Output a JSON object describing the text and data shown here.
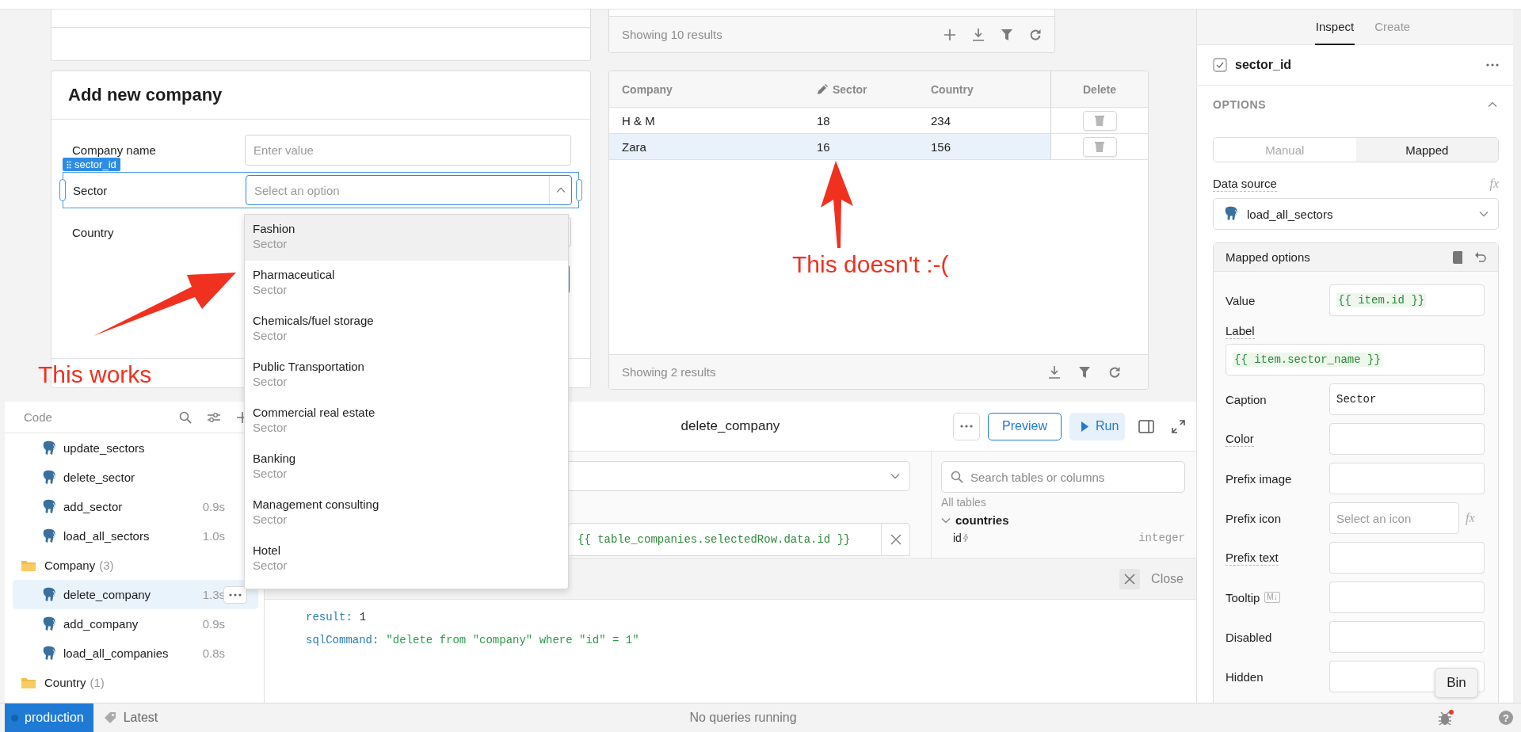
{
  "canvas": {
    "top_table": {
      "footer": "Showing 10 results"
    },
    "form": {
      "title": "Add new company",
      "fields": [
        {
          "label": "Company name",
          "kind": "text",
          "placeholder": "Enter value",
          "selected": false
        },
        {
          "label": "Sector",
          "kind": "select",
          "placeholder": "Select an option",
          "selected": true,
          "badge": "sector_id",
          "expanded": true
        },
        {
          "label": "Country",
          "kind": "select",
          "selected": false
        }
      ]
    },
    "dropdown": {
      "options": [
        {
          "label": "Fashion",
          "caption": "Sector",
          "selected": true
        },
        {
          "label": "Pharmaceutical",
          "caption": "Sector",
          "selected": false
        },
        {
          "label": "Chemicals/fuel storage",
          "caption": "Sector",
          "selected": false
        },
        {
          "label": "Public Transportation",
          "caption": "Sector",
          "selected": false
        },
        {
          "label": "Commercial real estate",
          "caption": "Sector",
          "selected": false
        },
        {
          "label": "Banking",
          "caption": "Sector",
          "selected": false
        },
        {
          "label": "Management consulting",
          "caption": "Sector",
          "selected": false
        },
        {
          "label": "Hotel",
          "caption": "Sector",
          "selected": false
        }
      ]
    },
    "table": {
      "columns": [
        {
          "label": "Company",
          "editable": false
        },
        {
          "label": "Sector",
          "editable": true
        },
        {
          "label": "Country",
          "editable": false
        },
        {
          "label": "Delete",
          "editable": false
        }
      ],
      "rows": [
        {
          "cells": [
            "H & M",
            "18",
            "234"
          ],
          "selected": false
        },
        {
          "cells": [
            "Zara",
            "16",
            "156"
          ],
          "selected": true
        }
      ],
      "footer": "Showing 2 results"
    },
    "annotations": [
      {
        "text": "This works"
      },
      {
        "text": "This doesn't :-("
      }
    ]
  },
  "code_panel": {
    "title": "Code",
    "items": [
      {
        "kind": "query",
        "name": "update_sectors",
        "selected": false
      },
      {
        "kind": "query",
        "name": "delete_sector",
        "selected": false
      },
      {
        "kind": "query",
        "name": "add_sector",
        "time": "0.9s",
        "selected": false
      },
      {
        "kind": "query",
        "name": "load_all_sectors",
        "time": "1.0s",
        "selected": false
      },
      {
        "kind": "folder",
        "name": "Company",
        "count": "(3)",
        "selected": false
      },
      {
        "kind": "query",
        "name": "delete_company",
        "time": "1.3s",
        "selected": true
      },
      {
        "kind": "query",
        "name": "add_company",
        "time": "0.9s",
        "selected": false
      },
      {
        "kind": "query",
        "name": "load_all_companies",
        "time": "0.8s",
        "selected": false
      },
      {
        "kind": "folder",
        "name": "Country",
        "count": "(1)",
        "selected": false
      }
    ]
  },
  "query_editor": {
    "title": "delete_company",
    "buttons": [
      {
        "label": "Preview",
        "kind": "outline"
      },
      {
        "label": "Run",
        "kind": "primary"
      }
    ],
    "parameter": "{{ table_companies.selectedRow.data.id }}",
    "schema": {
      "search_placeholder": "Search tables or columns",
      "section": "All tables",
      "tables": [
        {
          "name": "countries",
          "expanded": true,
          "columns": [
            {
              "name": "id",
              "type": "integer"
            }
          ]
        }
      ]
    },
    "results": {
      "close_label": "Close",
      "lines": [
        {
          "key": "result:",
          "value": "1",
          "kind": "number"
        },
        {
          "key": "sqlCommand:",
          "value": "\"delete from \"company\" where \"id\" = 1\"",
          "kind": "string"
        }
      ]
    }
  },
  "inspector": {
    "tabs": [
      {
        "label": "Inspect",
        "selected": true
      },
      {
        "label": "Create",
        "selected": false
      }
    ],
    "component": {
      "name": "sector_id",
      "checked": true
    },
    "section": {
      "title": "OPTIONS",
      "expanded": true
    },
    "mode": [
      {
        "label": "Manual",
        "selected": false
      },
      {
        "label": "Mapped",
        "selected": true
      }
    ],
    "data_source": {
      "label": "Data source",
      "formula": "fx",
      "value": "load_all_sectors"
    },
    "mapped": {
      "title": "Mapped options",
      "properties": [
        {
          "label": "Value",
          "kind": "code",
          "value": "{{ item.id }}",
          "hint": false
        },
        {
          "label": "Label",
          "kind": "code_wide",
          "value": "{{ item.sector_name }}",
          "hint": true
        },
        {
          "label": "Caption",
          "kind": "text",
          "value": "Sector",
          "hint": false
        },
        {
          "label": "Color",
          "kind": "text",
          "hint": true
        },
        {
          "label": "Prefix image",
          "kind": "text",
          "hint": false
        },
        {
          "label": "Prefix icon",
          "kind": "icon_select",
          "placeholder": "Select an icon",
          "formula": "fx",
          "hint": false
        },
        {
          "label": "Prefix text",
          "kind": "text",
          "hint": true
        },
        {
          "label": "Tooltip",
          "kind": "text",
          "badge": "M↓",
          "hint": false
        },
        {
          "label": "Disabled",
          "kind": "text",
          "hint": false
        },
        {
          "label": "Hidden",
          "kind": "text",
          "hint": false
        }
      ]
    }
  },
  "status_bar": {
    "environment": "production",
    "version": "Latest",
    "message": "No queries running",
    "help": "?",
    "tooltip": "Bin"
  }
}
